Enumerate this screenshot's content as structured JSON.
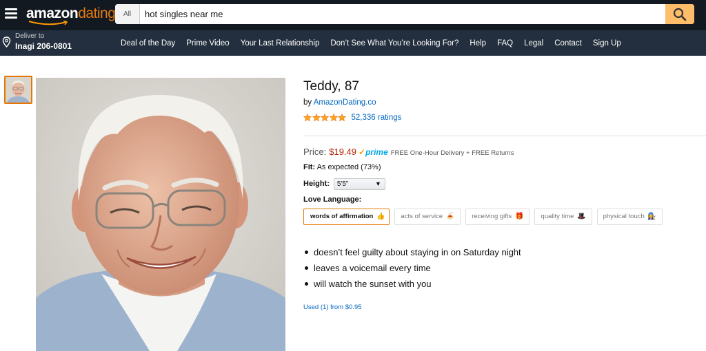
{
  "header": {
    "logo_main": "amazon",
    "logo_sub": "dating",
    "search_category": "All",
    "search_value": "hot singles near me"
  },
  "nav": {
    "deliver_line1": "Deliver to",
    "deliver_line2": "Inagi 206-0801",
    "links": [
      "Deal of the Day",
      "Prime Video",
      "Your Last Relationship",
      "Don’t See What You’re Looking For?",
      "Help",
      "FAQ",
      "Legal",
      "Contact",
      "Sign Up"
    ]
  },
  "product": {
    "title": "Teddy, 87",
    "by_prefix": "by",
    "seller": "AmazonDating.co",
    "rating": 5,
    "ratings_count": "52,336 ratings",
    "price_label": "Price:",
    "price": "$19.49",
    "prime_label": "prime",
    "delivery": "FREE One-Hour Delivery + FREE Returns",
    "fit_label": "Fit:",
    "fit_value": "As expected (73%)",
    "height_label": "Height:",
    "height_value": "5'5\"",
    "love_language_label": "Love Language:",
    "love_languages": [
      {
        "label": "words of affirmation",
        "emoji": "👍"
      },
      {
        "label": "acts of service",
        "emoji": "🍝"
      },
      {
        "label": "receiving gifts",
        "emoji": "🎁"
      },
      {
        "label": "quality time",
        "emoji": "🎩"
      },
      {
        "label": "physical touch",
        "emoji": "👩‍🔧"
      }
    ],
    "selected_love_language": 0,
    "bullets": [
      "doesn’t feel guilty about staying in on Saturday night",
      "leaves a voicemail every time",
      "will watch the sunset with you"
    ],
    "used_offer": "Used (1) from $0.95"
  },
  "colors": {
    "header_bg": "#131921",
    "nav_bg": "#232f3e",
    "search_button": "#febd69",
    "price": "#b12704",
    "link": "#0066c0",
    "accent": "#e77600",
    "star": "#ffa41c"
  }
}
